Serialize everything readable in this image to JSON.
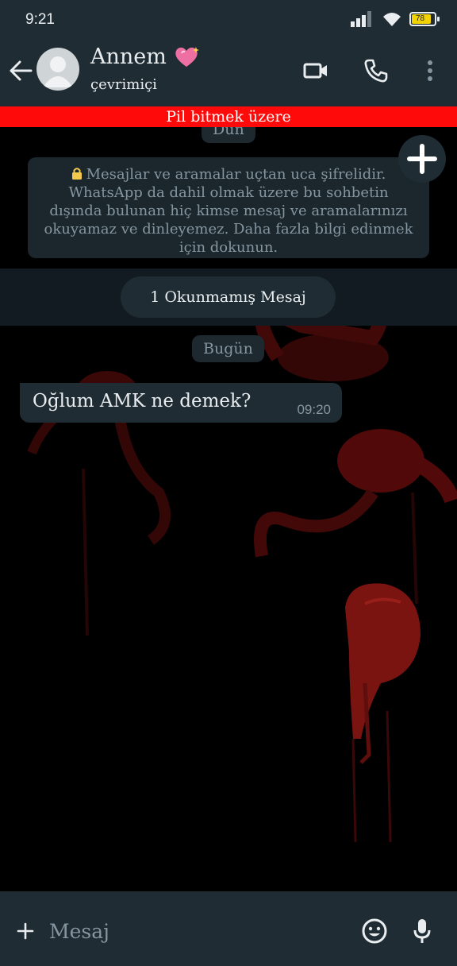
{
  "status_bar": {
    "time": "9:21",
    "battery_level": "78"
  },
  "header": {
    "contact_name": "Annem",
    "contact_status": "çevrimiçi"
  },
  "banner": {
    "text": "Pil bitmek üzere"
  },
  "chat": {
    "yesterday_label": "Dün",
    "encryption_notice": "Mesajlar ve aramalar uçtan uca şifrelidir. WhatsApp da dahil olmak üzere bu sohbetin dışında bulunan hiç kimse mesaj ve aramalarınızı okuyamaz ve dinleyemez. Daha fazla bilgi edinmek için dokunun.",
    "unread_label": "1 Okunmamış Mesaj",
    "today_label": "Bugün",
    "messages": [
      {
        "text": "Oğlum AMK ne demek?",
        "time": "09:20"
      }
    ]
  },
  "composer": {
    "placeholder": "Mesaj"
  },
  "colors": {
    "banner": "#ff0a0a",
    "bar": "#1f2c33",
    "accent": "#b11f12"
  }
}
